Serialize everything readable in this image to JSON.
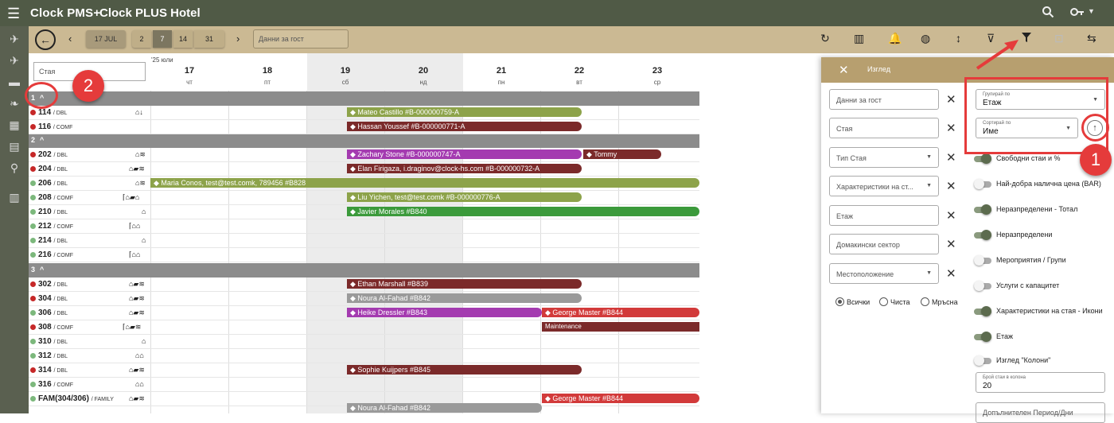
{
  "app": {
    "title": "Clock PMS+",
    "hotel": "Clock PLUS Hotel"
  },
  "toolbar": {
    "date_btn": "17 JUL",
    "day_options": [
      "2",
      "7",
      "14",
      "31"
    ],
    "guest_placeholder": "Данни за гост"
  },
  "grid": {
    "room_search_placeholder": "Стая",
    "month_label": "'25 юли",
    "days": [
      {
        "n": "17",
        "w": "чт"
      },
      {
        "n": "18",
        "w": "пт"
      },
      {
        "n": "19",
        "w": "сб"
      },
      {
        "n": "20",
        "w": "нд"
      },
      {
        "n": "21",
        "w": "пн"
      },
      {
        "n": "22",
        "w": "вт"
      },
      {
        "n": "23",
        "w": "ср"
      }
    ],
    "floors": [
      "1",
      "2",
      "3"
    ],
    "rooms": [
      {
        "name": "114",
        "type": "/ DBL",
        "status_color": "#c62828"
      },
      {
        "name": "116",
        "type": "/ COMF",
        "status_color": "#c62828"
      },
      {
        "name": "202",
        "type": "/ DBL",
        "status_color": "#c62828"
      },
      {
        "name": "204",
        "type": "/ DBL",
        "status_color": "#c62828"
      },
      {
        "name": "206",
        "type": "/ DBL",
        "status_color": "#7cb87c"
      },
      {
        "name": "208",
        "type": "/ COMF",
        "status_color": "#7cb87c"
      },
      {
        "name": "210",
        "type": "/ DBL",
        "status_color": "#7cb87c"
      },
      {
        "name": "212",
        "type": "/ COMF",
        "status_color": "#7cb87c"
      },
      {
        "name": "214",
        "type": "/ DBL",
        "status_color": "#7cb87c"
      },
      {
        "name": "216",
        "type": "/ COMF",
        "status_color": "#7cb87c"
      },
      {
        "name": "302",
        "type": "/ DBL",
        "status_color": "#c62828"
      },
      {
        "name": "304",
        "type": "/ DBL",
        "status_color": "#c62828"
      },
      {
        "name": "306",
        "type": "/ DBL",
        "status_color": "#7cb87c"
      },
      {
        "name": "308",
        "type": "/ COMF",
        "status_color": "#c62828"
      },
      {
        "name": "310",
        "type": "/ DBL",
        "status_color": "#7cb87c"
      },
      {
        "name": "312",
        "type": "/ DBL",
        "status_color": "#7cb87c"
      },
      {
        "name": "314",
        "type": "/ DBL",
        "status_color": "#c62828"
      },
      {
        "name": "316",
        "type": "/ COMF",
        "status_color": "#7cb87c"
      },
      {
        "name": "FAM(304/306)",
        "type": "/ FAMILY",
        "status_color": "#7cb87c"
      }
    ],
    "bookings": [
      {
        "label": "Mateo Castillo #B-000000759-A",
        "color": "#8da34a"
      },
      {
        "label": "Hassan Youssef #B-000000771-A",
        "color": "#7b2a2a"
      },
      {
        "label": "Zachary Stone #B-000000747-A",
        "color": "#a43bb0"
      },
      {
        "label": "Tommy",
        "color": "#7b2a2a"
      },
      {
        "label": "Elan Firigaza, i.draginov@clock-hs.com #B-000000732-A",
        "color": "#7b2a2a"
      },
      {
        "label": "Maria Conos, test@test.comk, 789456 #B828",
        "color": "#8da34a"
      },
      {
        "label": "Liu Yichen, test@test.comk #B-000000776-A",
        "color": "#8da34a"
      },
      {
        "label": "Javier Morales #B840",
        "color": "#3b9a3b"
      },
      {
        "label": "Ethan Marshall #B839",
        "color": "#7b2a2a"
      },
      {
        "label": "Noura Al-Fahad #B842",
        "color": "#9a9a9a"
      },
      {
        "label": "Heike Dressler #B843",
        "color": "#a43bb0"
      },
      {
        "label": "George Master #B844",
        "color": "#d23a3a"
      },
      {
        "label": "Maintenance",
        "color": "#7b2a2a"
      },
      {
        "label": "Sophie Kuijpers #B845",
        "color": "#7b2a2a"
      },
      {
        "label": "Noura Al-Fahad #B842",
        "color": "#9a9a9a"
      },
      {
        "label": "George Master #B844",
        "color": "#d23a3a"
      }
    ]
  },
  "panel": {
    "title": "Изглед",
    "filters": [
      "Данни за гост",
      "Стая",
      "Тип Стая",
      "Характеристики на ст...",
      "Етаж",
      "Домакински сектор",
      "Местоположение"
    ],
    "radios": [
      "Всички",
      "Чиста",
      "Мръсна"
    ],
    "group_by": {
      "label": "Групирай по",
      "value": "Етаж"
    },
    "sort_by": {
      "label": "Сортирай по",
      "value": "Име"
    },
    "toggles": [
      {
        "label": "Свободни стаи и %",
        "on": true
      },
      {
        "label": "Най-добра налична цена (BAR)",
        "on": false
      },
      {
        "label": "Неразпределени - Тотал",
        "on": true
      },
      {
        "label": "Неразпределени",
        "on": true
      },
      {
        "label": "Мероприятия / Групи",
        "on": false
      },
      {
        "label": "Услуги с капацитет",
        "on": false
      },
      {
        "label": "Характеристики на стая - Икони",
        "on": true
      },
      {
        "label": "Етаж",
        "on": true
      },
      {
        "label": "Изглед \"Колони\"",
        "on": false
      }
    ],
    "rooms_per_column": {
      "label": "Брой стаи в колона",
      "value": "20"
    },
    "extra_period_label": "Допълнителен Период/Дни"
  },
  "annotations": {
    "badge1": "1",
    "badge2": "2"
  }
}
